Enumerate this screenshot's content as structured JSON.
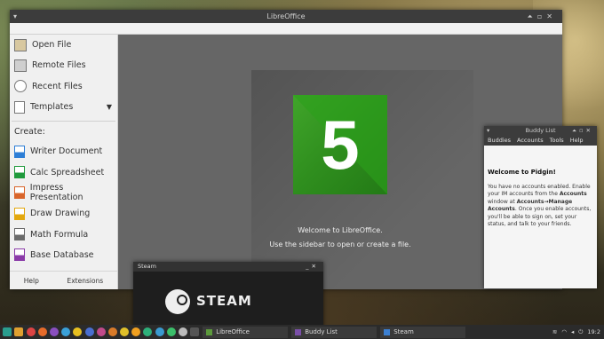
{
  "libreoffice": {
    "title": "LibreOffice",
    "sidebar": {
      "items": [
        {
          "label": "Open File",
          "icon": "folder-open-icon"
        },
        {
          "label": "Remote Files",
          "icon": "remote-files-icon"
        },
        {
          "label": "Recent Files",
          "icon": "clock-icon"
        },
        {
          "label": "Templates",
          "icon": "template-icon",
          "arrow": "▼"
        }
      ],
      "create_label": "Create:",
      "create_items": [
        {
          "label": "Writer Document",
          "icon": "writer-icon",
          "color": "#2d7ed6"
        },
        {
          "label": "Calc Spreadsheet",
          "icon": "calc-icon",
          "color": "#1f9a3c"
        },
        {
          "label": "Impress Presentation",
          "icon": "impress-icon",
          "color": "#d9652b"
        },
        {
          "label": "Draw Drawing",
          "icon": "draw-icon",
          "color": "#e3a80e"
        },
        {
          "label": "Math Formula",
          "icon": "math-icon",
          "color": "#6b6b6b"
        },
        {
          "label": "Base Database",
          "icon": "base-icon",
          "color": "#8a3aa8"
        }
      ],
      "help_label": "Help",
      "extensions_label": "Extensions"
    },
    "logo_text": "5",
    "welcome_line1": "Welcome to LibreOffice.",
    "welcome_line2": "Use the sidebar to open or create a file."
  },
  "buddy_list": {
    "title": "Buddy List",
    "menu": [
      "Buddies",
      "Accounts",
      "Tools",
      "Help"
    ],
    "heading": "Welcome to Pidgin!",
    "body_parts": {
      "p1": "You have no accounts enabled. Enable your IM accounts from the ",
      "b1": "Accounts",
      "p2": " window at ",
      "b2": "Accounts→Manage Accounts",
      "p3": ". Once you enable accounts, you'll be able to sign on, set your status, and talk to your friends."
    }
  },
  "steam": {
    "title": "Steam",
    "logo_text": "STEAM"
  },
  "taskbar": {
    "tasks": [
      {
        "label": "LibreOffice",
        "color": "#5c9a3c"
      },
      {
        "label": "Buddy List",
        "color": "#7a4fa8"
      },
      {
        "label": "Steam",
        "color": "#3b7fd1"
      }
    ],
    "clock": "19:2"
  }
}
